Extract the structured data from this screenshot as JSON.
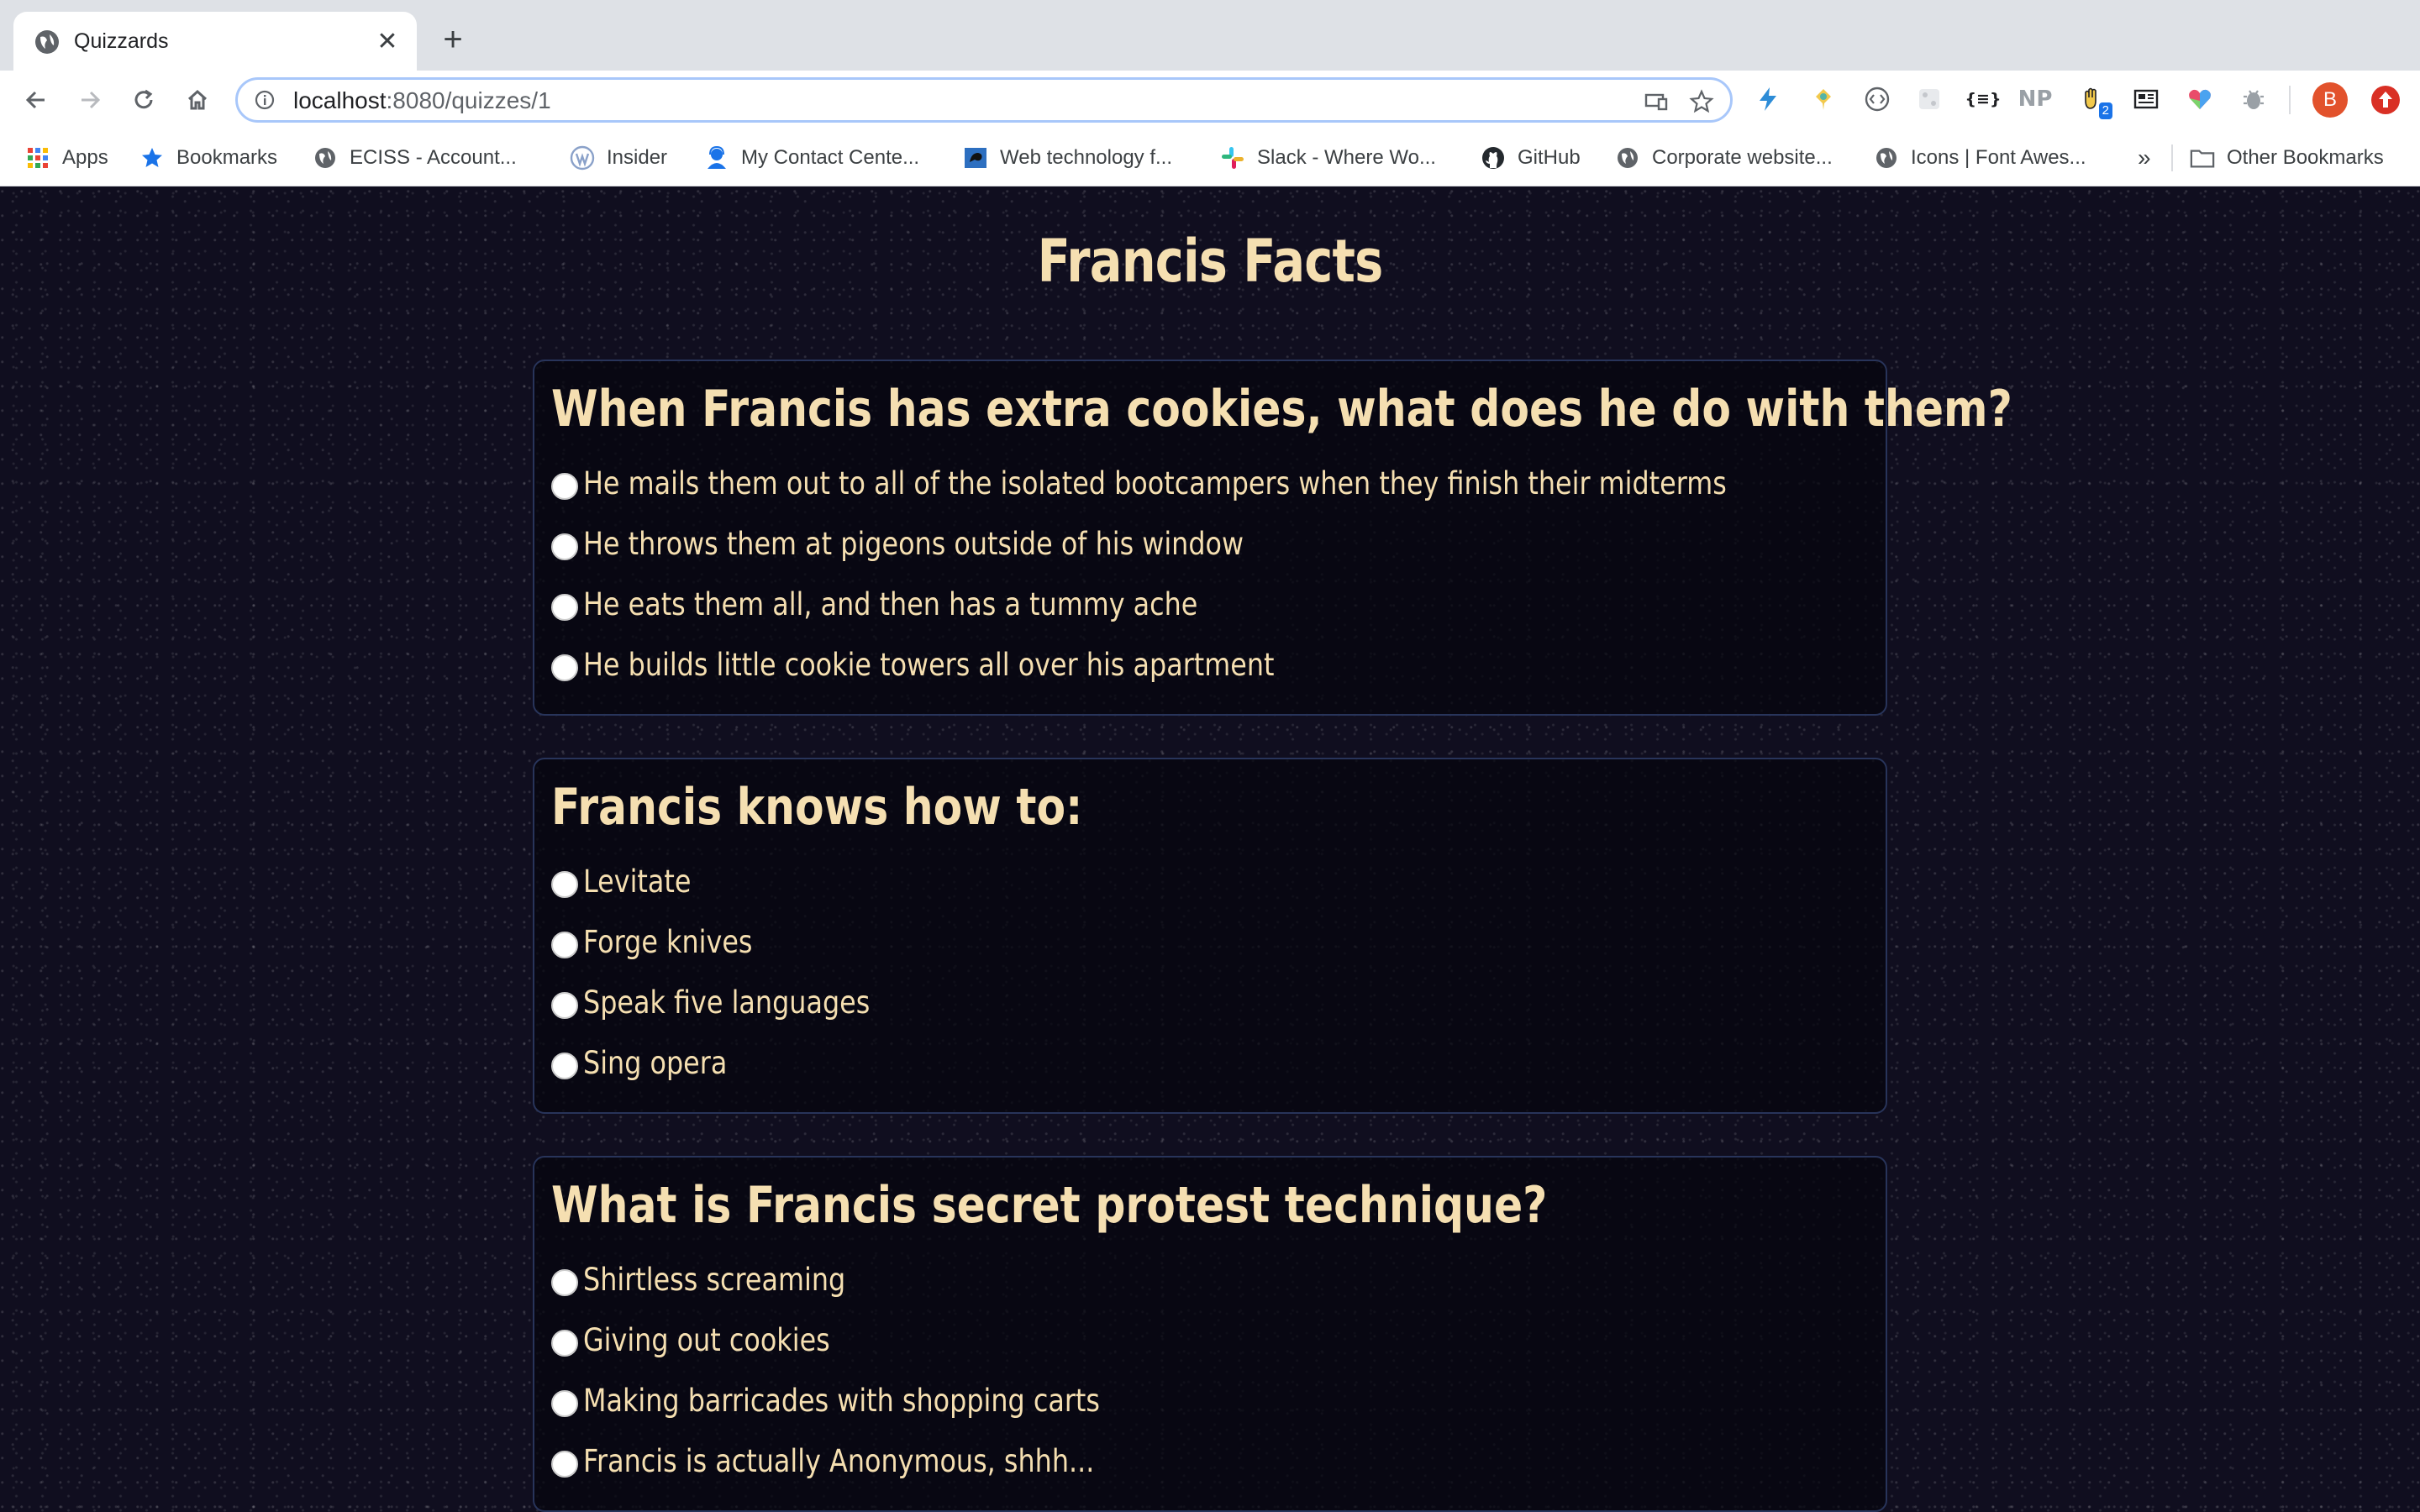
{
  "browser": {
    "tab": {
      "title": "Quizzards"
    },
    "address": {
      "host": "localhost",
      "rest": ":8080/quizzes/1"
    },
    "profile_initial": "B",
    "extension_badge": "2",
    "extension_np": "NP",
    "extension_json": "{≡}",
    "bookmarks": [
      {
        "label": "Apps",
        "icon": "apps-grid-icon"
      },
      {
        "label": "Bookmarks",
        "icon": "star-icon"
      },
      {
        "label": "ECISS - Account...",
        "icon": "globe-icon"
      },
      {
        "label": "Insider",
        "icon": "insider-icon"
      },
      {
        "label": "My Contact Cente...",
        "icon": "contact-center-icon"
      },
      {
        "label": "Web technology f...",
        "icon": "web-tech-icon"
      },
      {
        "label": "Slack - Where Wo...",
        "icon": "slack-icon"
      },
      {
        "label": "GitHub",
        "icon": "github-icon"
      },
      {
        "label": "Corporate website...",
        "icon": "globe-icon"
      },
      {
        "label": "Icons | Font Awes...",
        "icon": "globe-icon"
      }
    ],
    "overflow_label": "»",
    "other_bookmarks_label": "Other Bookmarks"
  },
  "quiz": {
    "title": "Francis Facts",
    "questions": [
      {
        "text": "When Francis has extra cookies, what does he do with them?",
        "answers": [
          "He mails them out to all of the isolated bootcampers when they finish their midterms",
          "He throws them at pigeons outside of his window",
          "He eats them all, and then has a tummy ache",
          "He builds little cookie towers all over his apartment"
        ]
      },
      {
        "text": "Francis knows how to:",
        "answers": [
          "Levitate",
          "Forge knives",
          "Speak five languages",
          "Sing opera"
        ]
      },
      {
        "text": "What is Francis secret protest technique?",
        "answers": [
          "Shirtless screaming",
          "Giving out cookies",
          "Making barricades with shopping carts",
          "Francis is actually Anonymous, shhh..."
        ]
      }
    ]
  },
  "colors": {
    "accent_text": "#f5dfb1",
    "page_background": "#100e1f",
    "card_border": "#28345a"
  }
}
